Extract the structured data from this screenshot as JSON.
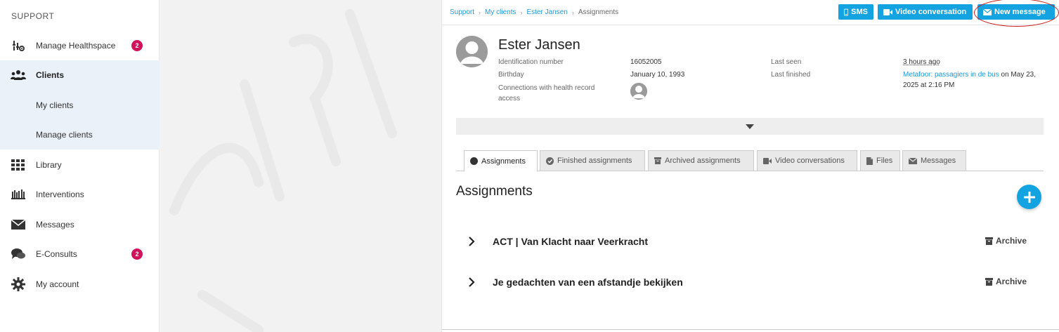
{
  "sidebar": {
    "title": "SUPPORT",
    "items": [
      {
        "label": "Manage Healthspace",
        "icon": "healthspace-icon",
        "badge": "2"
      },
      {
        "label": "Clients",
        "icon": "users-icon"
      },
      {
        "label": "My clients"
      },
      {
        "label": "Manage clients"
      },
      {
        "label": "Library",
        "icon": "grid-icon"
      },
      {
        "label": "Interventions",
        "icon": "books-icon"
      },
      {
        "label": "Messages",
        "icon": "envelope-icon"
      },
      {
        "label": "E-Consults",
        "icon": "chat-icon",
        "badge": "2"
      },
      {
        "label": "My account",
        "icon": "gear-icon"
      }
    ]
  },
  "breadcrumb": [
    "Support",
    "My clients",
    "Ester Jansen",
    "Assignments"
  ],
  "actions": {
    "sms": "SMS",
    "video": "Video conversation",
    "new_message": "New message"
  },
  "client": {
    "name": "Ester Jansen",
    "id_label": "Identification number",
    "id_value": "16052005",
    "birthday_label": "Birthday",
    "birthday_value": "January 10, 1993",
    "connections_label": "Connections with health record access",
    "last_seen_label": "Last seen",
    "last_seen_value": "3 hours ago",
    "last_finished_label": "Last finished",
    "last_finished_link": "Metafoor: passagiers in de bus",
    "last_finished_rest": " on May 23, 2025 at 2:16 PM"
  },
  "tabs": [
    {
      "label": "Assignments",
      "icon": "circle-icon"
    },
    {
      "label": "Finished assignments",
      "icon": "check-circle-icon"
    },
    {
      "label": "Archived assignments",
      "icon": "archive-icon"
    },
    {
      "label": "Video conversations",
      "icon": "video-icon"
    },
    {
      "label": "Files",
      "icon": "file-icon"
    },
    {
      "label": "Messages",
      "icon": "envelope-icon"
    }
  ],
  "section": {
    "title": "Assignments"
  },
  "assignments": [
    {
      "title": "ACT | Van Klacht naar Veerkracht",
      "action": "Archive"
    },
    {
      "title": "Je gedachten van een afstandje bekijken",
      "action": "Archive"
    }
  ],
  "colors": {
    "accent": "#12a3e0",
    "badge": "#d0135b",
    "highlight": "#cc1b1b"
  }
}
